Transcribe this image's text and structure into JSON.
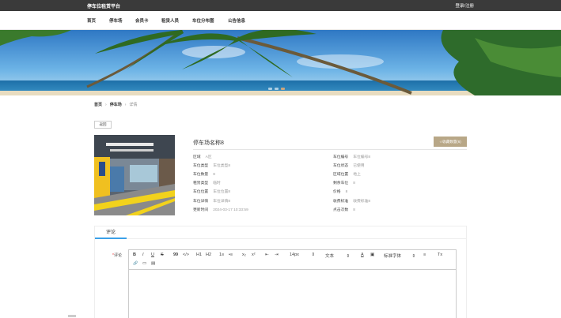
{
  "topbar": {
    "brand": "停车位租赁平台",
    "login": "登录/注册"
  },
  "nav": {
    "items": [
      {
        "label": "首页",
        "name": "nav-home"
      },
      {
        "label": "停车场",
        "name": "nav-parking"
      },
      {
        "label": "会员卡",
        "name": "nav-member-card"
      },
      {
        "label": "租赁人员",
        "name": "nav-tenants"
      },
      {
        "label": "车位分布图",
        "name": "nav-distribution-map"
      },
      {
        "label": "公告信息",
        "name": "nav-announcements"
      }
    ]
  },
  "breadcrumb": {
    "home": "首页",
    "section": "停车场",
    "current": "详情"
  },
  "back_label": "返回",
  "detail": {
    "title": "停车场名称8",
    "favorite_label": "收藏数量(6)",
    "left": [
      {
        "k": "区域",
        "v": "A区"
      },
      {
        "k": "车位类型",
        "v": "车位类型8"
      },
      {
        "k": "车位数量",
        "v": "8"
      },
      {
        "k": "租赁类型",
        "v": "临时"
      },
      {
        "k": "车位位置",
        "v": "车位位置8"
      },
      {
        "k": "车位详情",
        "v": "车位详情8"
      },
      {
        "k": "更新时间",
        "v": "2024-03-17 10:33:59"
      }
    ],
    "right": [
      {
        "k": "车位编号",
        "v": "车位编号8"
      },
      {
        "k": "车位状态",
        "v": "已使用"
      },
      {
        "k": "区域位置",
        "v": "地上"
      },
      {
        "k": "剩余车位",
        "v": "8"
      },
      {
        "k": "价格",
        "v": "8"
      },
      {
        "k": "收费标准",
        "v": "收费标准8"
      },
      {
        "k": "点击次数",
        "v": "8"
      }
    ]
  },
  "tabs": {
    "comment": "评论"
  },
  "comment": {
    "required_mark": "*",
    "label": "评论"
  },
  "toolbar": {
    "bold": "B",
    "italic": "I",
    "underline": "U",
    "strike": "S",
    "quote": "99",
    "code": "</>",
    "h1": "H1",
    "h2": "H2",
    "ol": "1≡",
    "ul": "•≡",
    "sub": "x₂",
    "sup": "x²",
    "indent_left": "⇤",
    "indent_right": "⇥",
    "size": "14px",
    "paragraph": "文本",
    "font": "标准字体",
    "color": "A",
    "bg": "▣",
    "align": "≡",
    "clear": "Tx",
    "link": "🔗",
    "image": "▭",
    "video": "▤"
  },
  "colors": {
    "accent": "#3aa0e8",
    "fav": "#b8a787",
    "topbar": "#3a3a3a"
  }
}
